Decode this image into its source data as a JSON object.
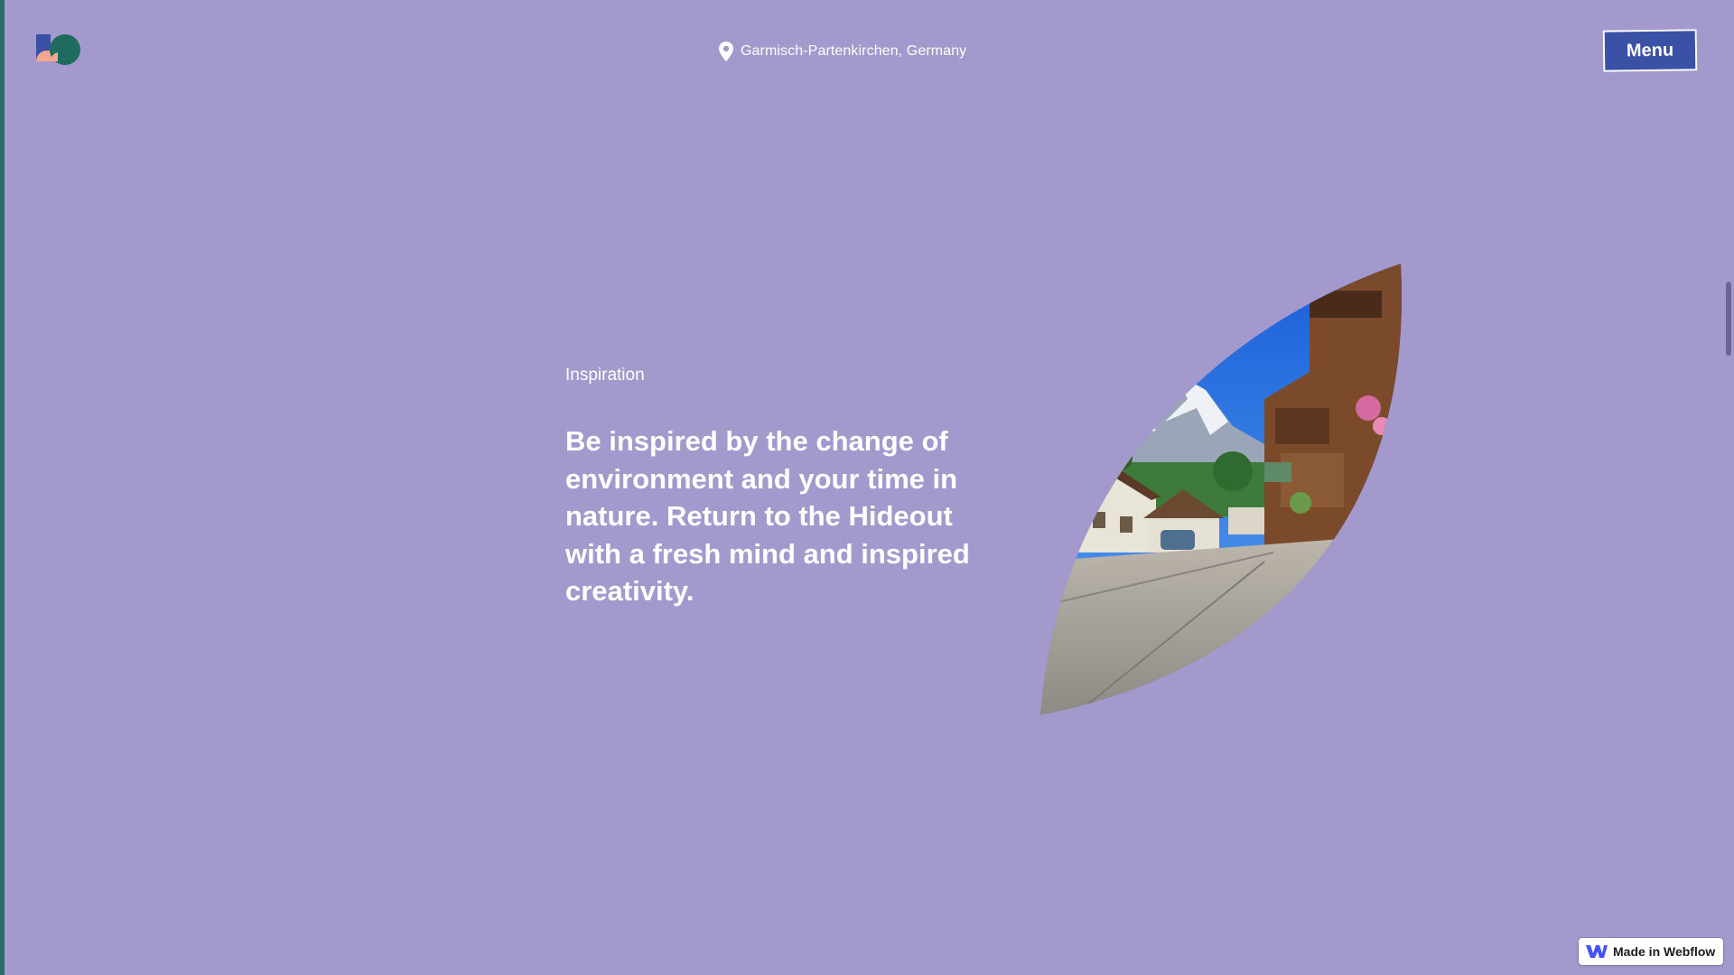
{
  "header": {
    "logo_icon": "hideout-logo-icon",
    "location_icon": "map-pin-icon",
    "location_text": "Garmisch-Partenkirchen, Germany",
    "menu_label": "Menu"
  },
  "section": {
    "eyebrow": "Inspiration",
    "headline": "Be inspired by the change of environment and your time in nature. Return to the Hideout with a fresh mind and inspired creativity.",
    "image_icon": "leaf-shaped-village-photo"
  },
  "badge": {
    "icon": "webflow-logo-icon",
    "label": "Made in Webflow"
  },
  "colors": {
    "background": "#a399cc",
    "menu_button": "#3a51a6",
    "text": "#ffffff",
    "left_edge": "#2f6b66"
  }
}
